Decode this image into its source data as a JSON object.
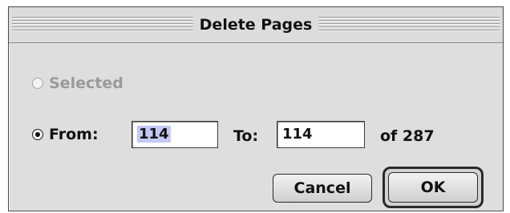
{
  "dialog": {
    "title": "Delete Pages"
  },
  "options": {
    "selected": {
      "label": "Selected",
      "checked": false,
      "disabled": true
    },
    "range": {
      "label": "From:",
      "checked": true,
      "from_value": "114",
      "to_label": "To:",
      "to_value": "114",
      "of_text": "of 287"
    }
  },
  "buttons": {
    "cancel_label": "Cancel",
    "ok_label": "OK"
  }
}
